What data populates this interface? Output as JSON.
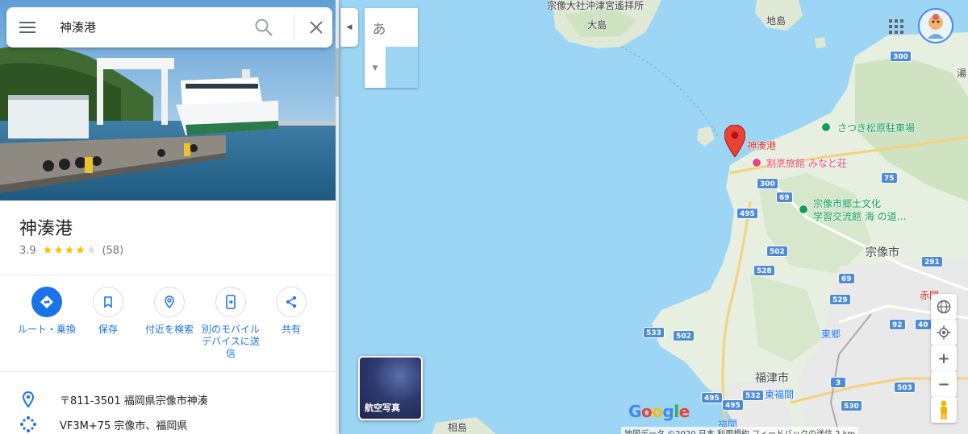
{
  "search": {
    "query": "神湊港"
  },
  "place": {
    "name": "神湊港",
    "rating": "3.9",
    "stars_filled": 4,
    "stars_total": 5,
    "review_count": "(58)"
  },
  "actions": [
    {
      "label": "ルート・乗換",
      "icon": "directions-icon"
    },
    {
      "label": "保存",
      "icon": "bookmark-icon"
    },
    {
      "label": "付近を検索",
      "icon": "nearby-icon"
    },
    {
      "label": "別のモバイルデバイスに送信",
      "icon": "send-to-phone-icon"
    },
    {
      "label": "共有",
      "icon": "share-icon"
    }
  ],
  "info": {
    "address": "〒811-3501 福岡県宗像市神湊",
    "plus_code": "VF3M+75 宗像市、福岡県"
  },
  "ime": {
    "char": "あ"
  },
  "map": {
    "labels": {
      "shrine": "宗像大社沖津宮遙拝所",
      "oshima": "大島",
      "jinoshima": "地島",
      "marker": "神湊港",
      "satsuki": "さつき松原駐車場",
      "minatoso": "割烹旅館 みなと荘",
      "museum1": "宗像市郷土文化",
      "museum2": "学習交流館 海 の道…",
      "munakata": "宗像市",
      "akama": "赤間",
      "togo": "東郷",
      "fukutsu": "福津市",
      "higashifukuma": "東福間",
      "fukuma": "福間",
      "aijima": "相島",
      "topright": "湯"
    },
    "shields": [
      "300",
      "300",
      "75",
      "69",
      "495",
      "502",
      "528",
      "69",
      "291",
      "529",
      "92",
      "533",
      "502",
      "40",
      "3",
      "495",
      "532",
      "530",
      "503",
      "495"
    ]
  },
  "satellite": {
    "label": "航空写真"
  },
  "attribution": {
    "logo": "Google",
    "text": "地図データ ©2020   日本   利用規約   フィードバックの送信   2 km"
  },
  "colors": {
    "accent": "#1a73e8",
    "water": "#9dd5f5",
    "land": "#e6efe0",
    "marker": "#ea4335",
    "star": "#fbbc04"
  }
}
